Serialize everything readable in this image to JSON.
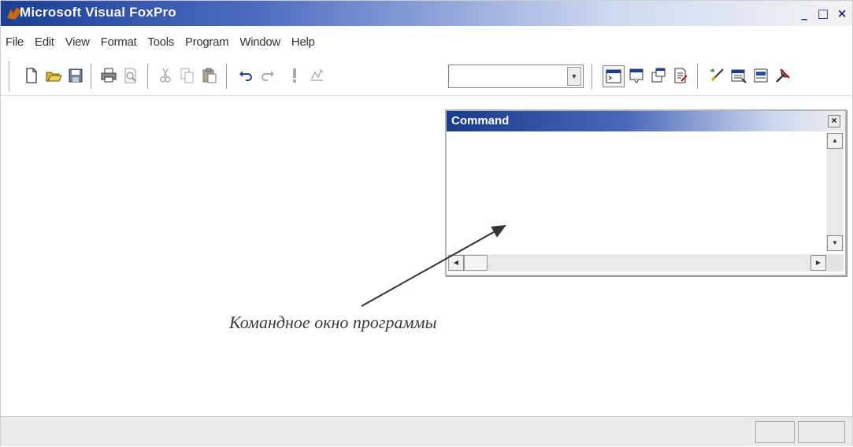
{
  "window": {
    "title": "Microsoft Visual FoxPro",
    "controls": {
      "minimize": "_",
      "maximize": "□",
      "close": "×"
    }
  },
  "menu": {
    "items": [
      "File",
      "Edit",
      "View",
      "Format",
      "Tools",
      "Program",
      "Window",
      "Help"
    ]
  },
  "toolbar": {
    "buttons": [
      "new-file-icon",
      "open-folder-icon",
      "save-icon",
      "print-icon",
      "print-preview-icon",
      "cut-icon",
      "copy-icon",
      "paste-icon",
      "undo-icon",
      "redo-icon",
      "run-icon",
      "modify-form-icon",
      "command-window-icon",
      "data-session-icon",
      "properties-icon",
      "code-icon",
      "form-wizard-icon",
      "report-wizard-icon",
      "table-wizard-icon",
      "tools-icon"
    ],
    "combo_value": ""
  },
  "command_window": {
    "title": "Command",
    "close_label": "×",
    "content": ""
  },
  "annotation": {
    "text": "Командное окно программы"
  },
  "colors": {
    "titlebar_dark": "#1b3f96",
    "titlebar_light": "#f3f3f3",
    "command_titlebar": "#1a3a8c"
  }
}
